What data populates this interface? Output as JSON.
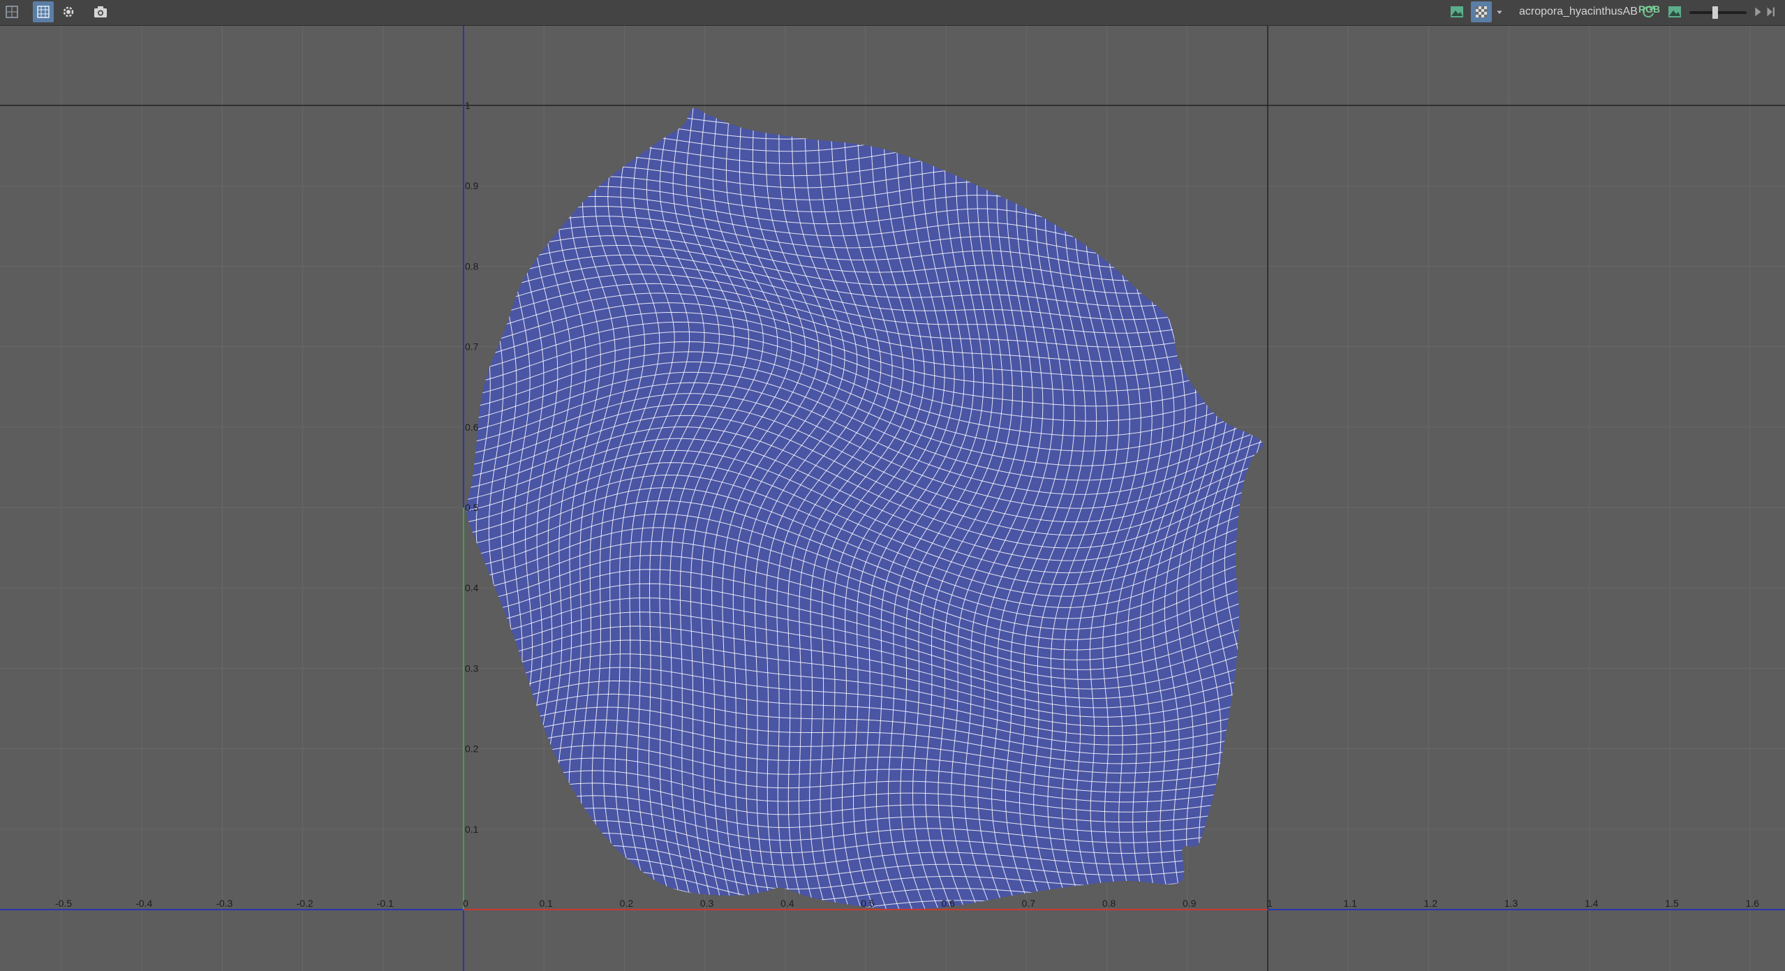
{
  "toolbar": {
    "left_icons": [
      {
        "name": "uv-editor-icon",
        "active": false
      },
      {
        "name": "grid-icon",
        "active": true
      },
      {
        "name": "gear-icon",
        "active": false
      },
      {
        "name": "camera-icon",
        "active": false
      }
    ],
    "uv_set_name": "acropora_hyacinthusAB",
    "channel_label": "RGB",
    "right_icons": [
      "image-display-icon",
      "checker-icon",
      "dropdown-arrow-icon",
      "refresh-icon",
      "image-icon",
      "play-icon",
      "end-icon"
    ],
    "exposure_value": 0.45
  },
  "viewport": {
    "background": "#5d5d5d",
    "uv_fill_color": "#4a55a4",
    "wire_color": "#ffffff",
    "u_axis_labels": [
      "-0.5",
      "-0.4",
      "-0.3",
      "-0.2",
      "-0.1",
      "0",
      "0.1",
      "0.2",
      "0.3",
      "0.4",
      "0.5",
      "0.6",
      "0.7",
      "0.8",
      "0.9",
      "1",
      "1.1",
      "1.2",
      "1.3",
      "1.4",
      "1.5",
      "1.6"
    ],
    "v_axis_labels": [
      "0.1",
      "0.2",
      "0.3",
      "0.4",
      "0.5",
      "0.6",
      "0.7",
      "0.8",
      "0.9",
      "1"
    ],
    "u_axis_color": "#c83a2e",
    "v_axis_color": "#37a847",
    "axis_line_color": "#2a35b0"
  }
}
